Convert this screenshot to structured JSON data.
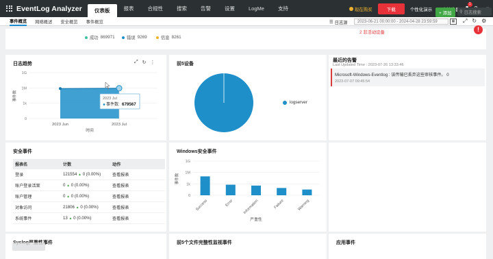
{
  "app": {
    "name": "EventLog Analyzer",
    "nav_tabs": [
      "仪表板",
      "报表",
      "合规性",
      "搜索",
      "告警",
      "设置",
      "LogMe",
      "支持"
    ],
    "active_tab": 0,
    "buy_label": "现在购买",
    "download_label": "下载",
    "demo_label": "个性化演示",
    "license_label": "日志接收器",
    "notif_count": "1",
    "help_icon": "?",
    "user_icon": "user-icon"
  },
  "subnav": {
    "tabs": [
      "事件概览",
      "网络概述",
      "安全概览",
      "事件概览"
    ],
    "active_tab": 0,
    "add_label": "+ 添加",
    "search_placeholder": "日志搜索",
    "log_source_label": "日志源",
    "date_range": "2023-06-21 00:00:00 - 2024-04-28 23:59:59"
  },
  "stats": {
    "success_label": "成功",
    "success_value": "869971",
    "error_label": "错误",
    "error_value": "9269",
    "info_label": "信息",
    "info_value": "8261",
    "inactive_label": "2 非活动设备",
    "colors": {
      "success": "#3fbf9f",
      "error": "#1f8fc9",
      "info": "#f0b22e"
    }
  },
  "trend": {
    "title": "日志趋势",
    "tooltip_date": "2023 Jul",
    "tooltip_label": "事件数:",
    "tooltip_value": "679567"
  },
  "top5": {
    "title": "前5设备",
    "legend": "logserver"
  },
  "alerts": {
    "title": "最近的告警",
    "updated": "Last Updated Time : 2023-07-26 13:33:46",
    "item_text": "Microsoft-Windows-Eventlog : 该传输已丢弃这些审核事件。 0",
    "item_time": "2023-07-07 09:45:54"
  },
  "security": {
    "title": "安全事件",
    "headers": [
      "报表名",
      "计数",
      "动作"
    ],
    "rows": [
      {
        "name": "登录",
        "count": "121554",
        "change": "0 (0.00%)",
        "action": "查看报表"
      },
      {
        "name": "账户登录活案",
        "count": "0",
        "change": "0 (0.00%)",
        "action": "查看报表"
      },
      {
        "name": "账户管理",
        "count": "0",
        "change": "0 (0.00%)",
        "action": "查看报表"
      },
      {
        "name": "对象访问",
        "count": "21806",
        "change": "0 (0.00%)",
        "action": "查看报表"
      },
      {
        "name": "系统事件",
        "count": "13",
        "change": "0 (0.00%)",
        "action": "查看报表"
      }
    ]
  },
  "winsec": {
    "title": "Windows安全事件"
  },
  "bottom": {
    "syslog_title": "Syslog严重性事件",
    "fim_title": "前5个文件完整性监视事件",
    "app_title": "应用事件"
  },
  "chart_data": [
    {
      "type": "area",
      "title": "日志趋势",
      "categories": [
        "2023 Jun",
        "2023 Jul"
      ],
      "values": [
        742000,
        879567
      ],
      "xlabel": "时间",
      "ylabel": "事件数",
      "yticks": [
        "0",
        "1k",
        "1M",
        "1G"
      ],
      "color": "#1f8fc9"
    },
    {
      "type": "pie",
      "title": "前5设备",
      "categories": [
        "logserver"
      ],
      "values": [
        100
      ],
      "color": "#1f8fc9"
    },
    {
      "type": "bar",
      "title": "Windows安全事件",
      "categories": [
        "Success",
        "Error",
        "Information",
        "Failure",
        "Warning"
      ],
      "values": [
        800000,
        420000,
        380000,
        270000,
        200000
      ],
      "xlabel": "严重性",
      "ylabel": "事件数",
      "yticks": [
        "0",
        "1k",
        "1M",
        "1G"
      ],
      "color": "#1f8fc9"
    }
  ]
}
